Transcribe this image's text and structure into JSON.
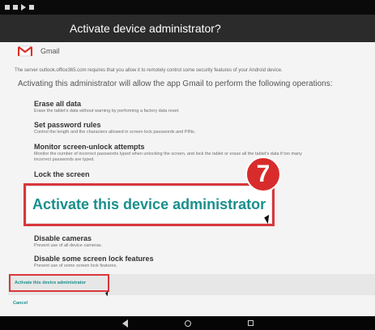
{
  "header": {
    "title": "Activate device administrator?"
  },
  "app": {
    "name": "Gmail",
    "icon": "gmail-icon"
  },
  "content": {
    "intro": "The server outlook.office365.com requires that you allow it to remotely control some security features of your Android device.",
    "operations_intro": "Activating this administrator will allow the app Gmail to perform the following operations:",
    "policies": [
      {
        "title": "Erase all data",
        "description": "Erase the tablet's data without warning by performing a factory data reset."
      },
      {
        "title": "Set password rules",
        "description": "Control the length and the characters allowed in screen lock passwords and PINs."
      },
      {
        "title": "Monitor screen-unlock attempts",
        "description": "Monitor the number of incorrect passwords typed when unlocking the screen, and lock the tablet or erase all the tablet's data if too many incorrect passwords are typed."
      },
      {
        "title": "Lock the screen",
        "description": ""
      },
      {
        "title": "Disable cameras",
        "description": "Prevent use of all device cameras."
      },
      {
        "title": "Disable some screen lock features",
        "description": "Prevent use of some screen lock features."
      }
    ]
  },
  "callout": {
    "step_number": "7",
    "button_label": "Activate this device administrator"
  },
  "actions": {
    "activate_label": "Activate this device administrator",
    "cancel_label": "Cancel"
  },
  "colors": {
    "accent": "#1a8f8c",
    "highlight": "#d9373a",
    "title_bar": "#2b2b2b"
  }
}
